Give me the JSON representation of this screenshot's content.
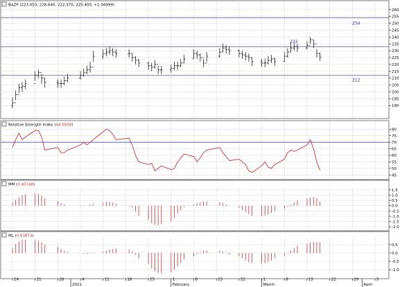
{
  "panels": {
    "price": {
      "title": "BAZP (223.050, 228.640, 222.370, 225.400, +1.04999)"
    },
    "rsi": {
      "title_prefix": "Relative Strength Index (",
      "value": "48.5938",
      "title_suffix": ")"
    },
    "mm": {
      "title_prefix": "MM (",
      "value": "0.40748",
      "title_suffix": ")"
    },
    "ml": {
      "title_prefix": "ML (",
      "value": "0.63873",
      "title_suffix": ")"
    }
  },
  "colors": {
    "line_red": "#d03030",
    "bar_black": "#000000",
    "hline_blue": "#4a4aa8",
    "label_blue": "#3030a0",
    "grid": "#d8d8d8",
    "border": "#7a7a7a"
  },
  "chart_data": [
    {
      "type": "ohlc",
      "name": "price",
      "ylim": [
        181,
        266
      ],
      "yticks": [
        190,
        195,
        200,
        205,
        210,
        215,
        220,
        225,
        230,
        235,
        240,
        245,
        250,
        255,
        260
      ],
      "hlines": [
        {
          "value": 254,
          "label": "254"
        },
        {
          "value": 233,
          "label": "233"
        },
        {
          "value": 212,
          "label": "212"
        }
      ],
      "dates": [
        "2020-12-14",
        "2020-12-15",
        "2020-12-16",
        "2020-12-17",
        "2020-12-18",
        "2020-12-21",
        "2020-12-22",
        "2020-12-23",
        "2020-12-24",
        "2020-12-28",
        "2020-12-29",
        "2020-12-30",
        "2020-12-31",
        "2021-01-04",
        "2021-01-05",
        "2021-01-06",
        "2021-01-07",
        "2021-01-08",
        "2021-01-11",
        "2021-01-12",
        "2021-01-13",
        "2021-01-14",
        "2021-01-15",
        "2021-01-19",
        "2021-01-20",
        "2021-01-21",
        "2021-01-22",
        "2021-01-25",
        "2021-01-26",
        "2021-01-27",
        "2021-01-28",
        "2021-01-29",
        "2021-02-01",
        "2021-02-02",
        "2021-02-03",
        "2021-02-04",
        "2021-02-05",
        "2021-02-08",
        "2021-02-09",
        "2021-02-10",
        "2021-02-11",
        "2021-02-12",
        "2021-02-16",
        "2021-02-17",
        "2021-02-18",
        "2021-02-19",
        "2021-02-22",
        "2021-02-23",
        "2021-02-24",
        "2021-02-25",
        "2021-02-26",
        "2021-03-01",
        "2021-03-02",
        "2021-03-03",
        "2021-03-04",
        "2021-03-05",
        "2021-03-08",
        "2021-03-09",
        "2021-03-10",
        "2021-03-11",
        "2021-03-12",
        "2021-03-15",
        "2021-03-16",
        "2021-03-17",
        "2021-03-18",
        "2021-03-19"
      ],
      "close": [
        192,
        198,
        203,
        204,
        206,
        212,
        214,
        210,
        207,
        206,
        206,
        208,
        210,
        212,
        214,
        216,
        218,
        226,
        228,
        229,
        230,
        229,
        228,
        228,
        225,
        223,
        221,
        219,
        218,
        220,
        216,
        216,
        217,
        219,
        219,
        221,
        224,
        228,
        227,
        225,
        221,
        226,
        229,
        232,
        231,
        230,
        228,
        227,
        226,
        225,
        222,
        221,
        221,
        223,
        224,
        222,
        226,
        229,
        232,
        233,
        232,
        234,
        238,
        235,
        228,
        225.4
      ],
      "high": [
        196,
        201,
        206,
        207,
        209,
        215,
        216,
        213,
        210,
        209,
        209,
        211,
        213,
        215,
        217,
        219,
        222,
        230,
        231,
        232,
        233,
        232,
        231,
        231,
        228,
        226,
        224,
        222,
        221,
        223,
        219,
        219,
        220,
        222,
        222,
        224,
        227,
        231,
        230,
        228,
        224,
        229,
        232,
        235,
        234,
        233,
        231,
        230,
        229,
        228,
        225,
        224,
        224,
        226,
        227,
        225,
        229,
        232,
        236,
        236,
        235,
        237,
        240,
        238,
        231,
        228.6
      ],
      "low": [
        188,
        194,
        199,
        200,
        202,
        208,
        210,
        206,
        203,
        203,
        203,
        205,
        207,
        209,
        211,
        213,
        214,
        222,
        224,
        226,
        227,
        226,
        225,
        225,
        222,
        220,
        218,
        216,
        215,
        217,
        213,
        213,
        214,
        216,
        216,
        218,
        221,
        224,
        224,
        222,
        218,
        222,
        225,
        229,
        228,
        227,
        225,
        224,
        223,
        222,
        219,
        218,
        218,
        220,
        221,
        219,
        222,
        225,
        229,
        230,
        229,
        231,
        235,
        232,
        225,
        222.4
      ]
    },
    {
      "type": "line",
      "name": "Relative Strength Index",
      "ylim": [
        42,
        86
      ],
      "yticks": [
        45,
        50,
        55,
        60,
        65,
        70,
        75,
        80
      ],
      "hlines": [
        70
      ],
      "values": [
        66,
        72,
        77,
        72,
        74,
        79,
        79,
        74,
        64,
        66,
        62,
        62,
        64,
        68,
        70,
        68,
        70,
        72,
        78,
        80,
        79,
        76,
        72,
        73,
        68,
        60,
        55,
        53,
        54,
        48,
        50,
        52,
        49,
        50,
        55,
        58,
        61,
        59,
        55,
        58,
        62,
        64,
        66,
        62,
        59,
        56,
        57,
        55,
        53,
        48,
        47,
        52,
        55,
        51,
        50,
        53,
        57,
        62,
        64,
        63,
        64,
        68,
        72,
        65,
        55,
        48.6
      ]
    },
    {
      "type": "bar",
      "name": "MM",
      "ylim": [
        -2.25,
        1.75
      ],
      "yticks": [
        1.5,
        1.0,
        0.5,
        0.0,
        -0.5,
        -1.0,
        -1.5,
        -2.0
      ],
      "values": [
        0.3,
        0.55,
        0.8,
        1.0,
        1.1,
        1.15,
        1.1,
        0.95,
        0.7,
        0.45,
        0.25,
        0.1,
        0.0,
        -0.05,
        -0.05,
        0.0,
        0.1,
        0.2,
        0.3,
        0.35,
        0.35,
        0.3,
        0.2,
        0.05,
        -0.2,
        -0.55,
        -0.95,
        -1.35,
        -1.65,
        -1.8,
        -1.85,
        -1.75,
        -1.5,
        -1.15,
        -0.75,
        -0.4,
        -0.1,
        0.1,
        0.25,
        0.35,
        0.4,
        0.4,
        0.35,
        0.25,
        0.1,
        -0.05,
        -0.2,
        -0.4,
        -0.6,
        -0.8,
        -0.95,
        -1.0,
        -0.95,
        -0.85,
        -0.7,
        -0.5,
        -0.3,
        -0.1,
        0.1,
        0.3,
        0.5,
        0.65,
        0.75,
        0.8,
        0.7,
        0.41
      ]
    },
    {
      "type": "bar",
      "name": "ML",
      "ylim": [
        -1.45,
        0.95
      ],
      "yticks": [
        0.5,
        0.0,
        -0.5,
        -1.0
      ],
      "values": [
        0.3,
        0.55,
        0.7,
        0.78,
        0.8,
        0.78,
        0.72,
        0.62,
        0.5,
        0.38,
        0.25,
        0.15,
        0.06,
        0.0,
        -0.05,
        -0.05,
        -0.03,
        0.02,
        0.08,
        0.14,
        0.2,
        0.24,
        0.26,
        0.22,
        0.1,
        -0.1,
        -0.35,
        -0.65,
        -0.92,
        -1.1,
        -1.2,
        -1.22,
        -1.15,
        -1.0,
        -0.8,
        -0.58,
        -0.38,
        -0.2,
        -0.06,
        0.05,
        0.12,
        0.16,
        0.15,
        0.1,
        0.02,
        -0.08,
        -0.2,
        -0.32,
        -0.44,
        -0.54,
        -0.6,
        -0.62,
        -0.6,
        -0.54,
        -0.44,
        -0.32,
        -0.18,
        -0.02,
        0.14,
        0.3,
        0.44,
        0.55,
        0.62,
        0.66,
        0.65,
        0.64
      ]
    }
  ],
  "xaxis": {
    "ticks": [
      {
        "date": "2020-12-14",
        "label": "14"
      },
      {
        "date": "2020-12-21",
        "label": "21"
      },
      {
        "date": "2020-12-28",
        "label": "28"
      },
      {
        "date": "2021-01-04",
        "label": "4"
      },
      {
        "date": "2021-01-11",
        "label": "11"
      },
      {
        "date": "2021-01-18",
        "label": "18"
      },
      {
        "date": "2021-01-25",
        "label": "25"
      },
      {
        "date": "2021-02-01",
        "label": "1"
      },
      {
        "date": "2021-02-08",
        "label": "8"
      },
      {
        "date": "2021-02-15",
        "label": "15"
      },
      {
        "date": "2021-02-22",
        "label": "22"
      },
      {
        "date": "2021-03-01",
        "label": "1"
      },
      {
        "date": "2021-03-08",
        "label": "8"
      },
      {
        "date": "2021-03-15",
        "label": "15"
      },
      {
        "date": "2021-03-22",
        "label": "22"
      },
      {
        "date": "2021-03-29",
        "label": "29"
      },
      {
        "date": "2021-04-05",
        "label": "5"
      }
    ],
    "months": [
      {
        "date": "2021-01-01",
        "label": "2021"
      },
      {
        "date": "2021-02-01",
        "label": "February"
      },
      {
        "date": "2021-03-01",
        "label": "March"
      },
      {
        "date": "2021-04-01",
        "label": "April"
      }
    ]
  }
}
